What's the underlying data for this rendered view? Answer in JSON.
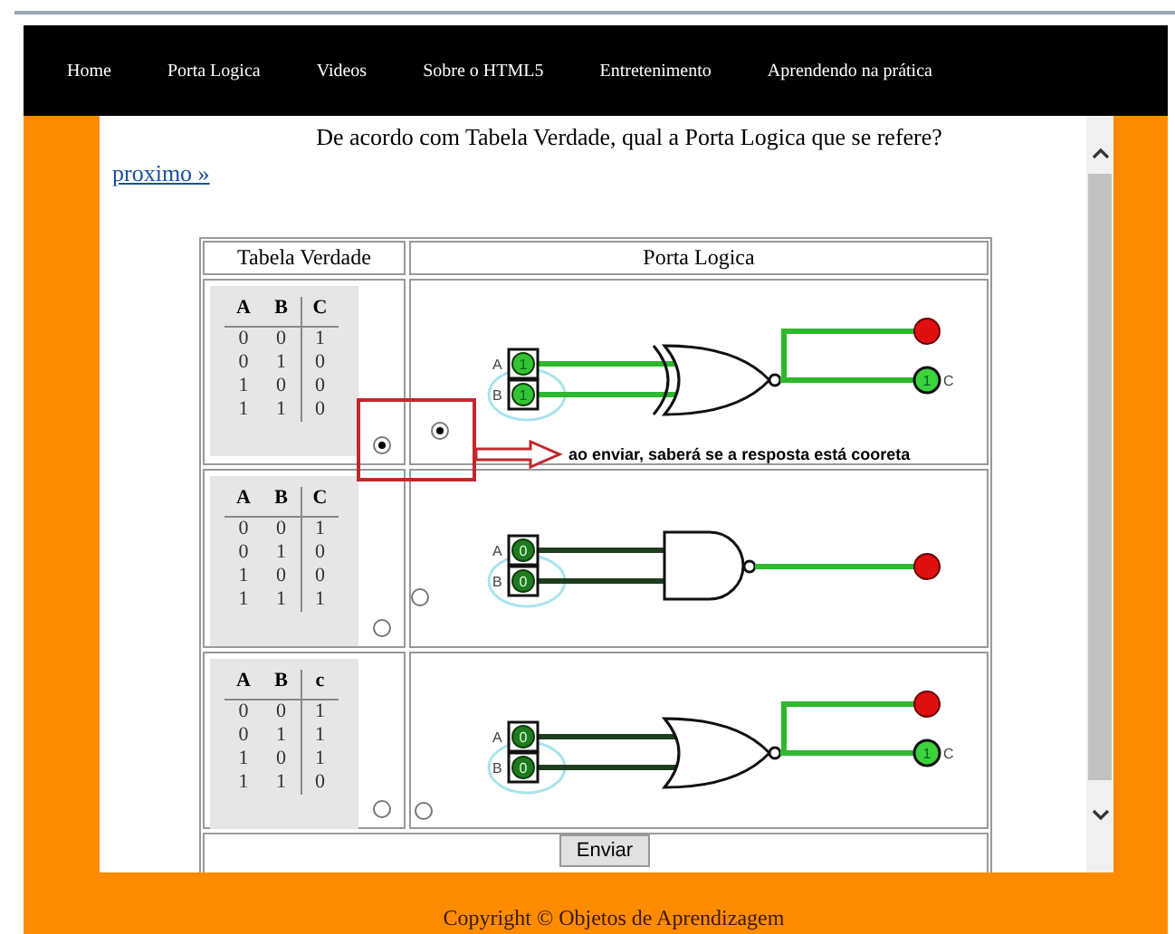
{
  "nav": [
    {
      "label": "Home"
    },
    {
      "label": "Porta Logica"
    },
    {
      "label": "Videos"
    },
    {
      "label": "Sobre o HTML5"
    },
    {
      "label": "Entretenimento"
    },
    {
      "label": "Aprendendo na prática"
    }
  ],
  "question": "De acordo com Tabela Verdade, qual a Porta Logica que se refere?",
  "next_link": "proximo »",
  "table": {
    "columns": [
      "Tabela Verdade",
      "Porta Logica"
    ],
    "rows": [
      {
        "truth_table": {
          "headers": [
            "A",
            "B",
            "C"
          ],
          "rows": [
            [
              "0",
              "0",
              "1"
            ],
            [
              "0",
              "1",
              "0"
            ],
            [
              "1",
              "0",
              "0"
            ],
            [
              "1",
              "1",
              "0"
            ]
          ]
        },
        "truth_selected": true,
        "gate_selected": true,
        "kind": "xnor",
        "inputs": [
          {
            "label": "A",
            "value": "1",
            "active": true
          },
          {
            "label": "B",
            "value": "1",
            "active": true
          }
        ],
        "outputs": [
          {
            "kind": "lamp"
          },
          {
            "kind": "pin",
            "label": "C",
            "value": "1"
          }
        ]
      },
      {
        "truth_table": {
          "headers": [
            "A",
            "B",
            "C"
          ],
          "rows": [
            [
              "0",
              "0",
              "1"
            ],
            [
              "0",
              "1",
              "0"
            ],
            [
              "1",
              "0",
              "0"
            ],
            [
              "1",
              "1",
              "1"
            ]
          ]
        },
        "truth_selected": false,
        "gate_selected": false,
        "kind": "nand",
        "inputs": [
          {
            "label": "A",
            "value": "0",
            "active": false
          },
          {
            "label": "B",
            "value": "0",
            "active": false
          }
        ],
        "outputs": [
          {
            "kind": "lamp"
          }
        ]
      },
      {
        "truth_table": {
          "headers": [
            "A",
            "B",
            "c"
          ],
          "rows": [
            [
              "0",
              "0",
              "1"
            ],
            [
              "0",
              "1",
              "1"
            ],
            [
              "1",
              "0",
              "1"
            ],
            [
              "1",
              "1",
              "0"
            ]
          ]
        },
        "truth_selected": false,
        "gate_selected": false,
        "kind": "nor",
        "inputs": [
          {
            "label": "A",
            "value": "0",
            "active": false
          },
          {
            "label": "B",
            "value": "0",
            "active": false
          }
        ],
        "outputs": [
          {
            "kind": "lamp"
          },
          {
            "kind": "pin",
            "label": "C",
            "value": "1"
          }
        ]
      }
    ]
  },
  "submit": "Enviar",
  "annotation": "ao enviar, saberá se a resposta está cooreta",
  "footer": "Copyright © Objetos de Aprendizagem"
}
